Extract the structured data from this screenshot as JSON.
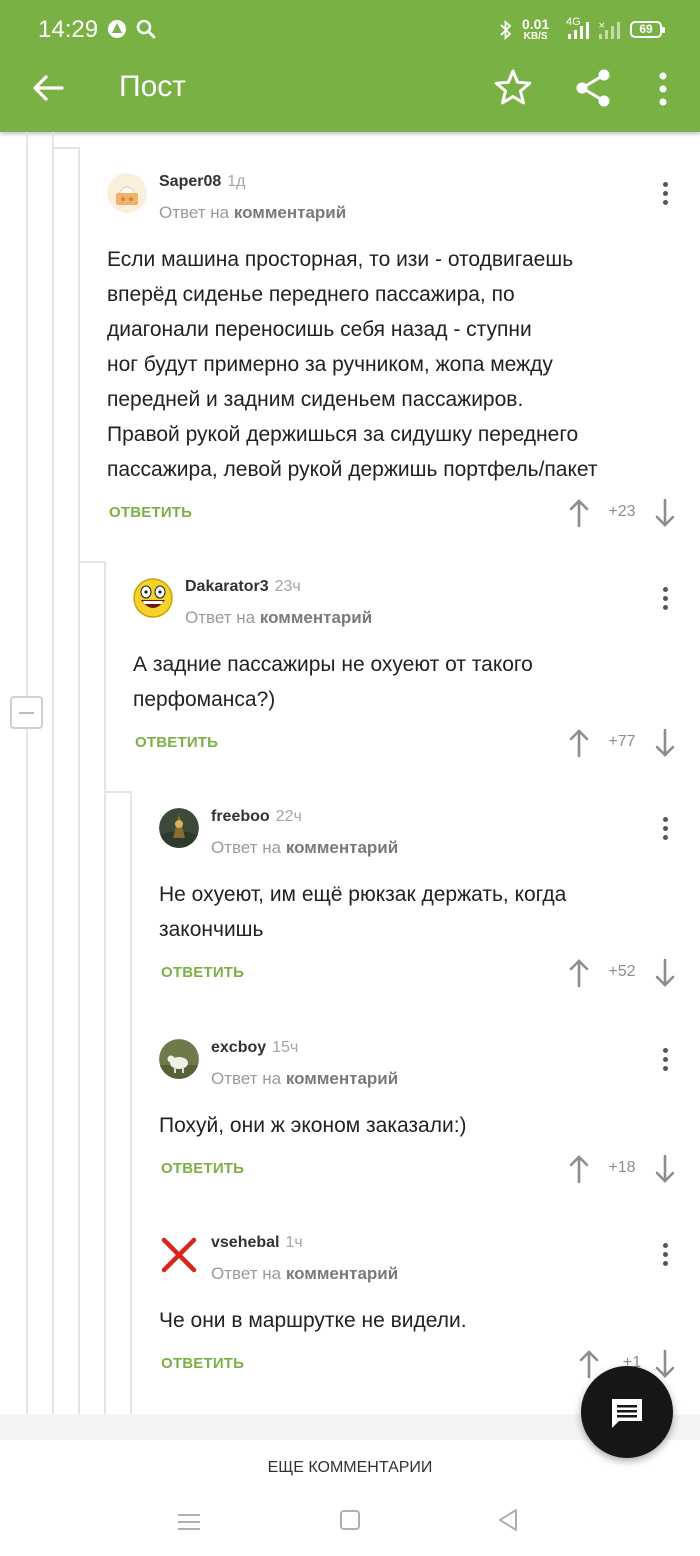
{
  "status_bar": {
    "time": "14:29",
    "net_speed_value": "0.01",
    "net_speed_unit": "KB/S",
    "network": "4G",
    "battery": "69"
  },
  "app_bar": {
    "title": "Пост"
  },
  "comments": [
    {
      "user": "Saper08",
      "time": "1д",
      "reply_prefix": "Ответ на",
      "reply_target": "комментарий",
      "text_lines": [
        "Если машина просторная, то изи - отодвигаешь",
        "вперёд сиденье переднего пассажира, по",
        "диагонали переносишь себя назад - ступни",
        "ног будут примерно за ручником, жопа между",
        "передней и задним сиденьем пассажиров.",
        "Правой рукой держишься за сидушку переднего",
        "пассажира, левой рукой держишь портфель/пакет"
      ],
      "reply_label": "ОТВЕТИТЬ",
      "score": "+23"
    },
    {
      "user": "Dakarator3",
      "time": "23ч",
      "reply_prefix": "Ответ на",
      "reply_target": "комментарий",
      "text_lines": [
        "А задние пассажиры не охуеют от такого",
        "перфоманса?)"
      ],
      "reply_label": "ОТВЕТИТЬ",
      "score": "+77"
    },
    {
      "user": "freeboo",
      "time": "22ч",
      "reply_prefix": "Ответ на",
      "reply_target": "комментарий",
      "text_lines": [
        "Не охуеют, им ещё рюкзак держать, когда",
        "закончишь"
      ],
      "reply_label": "ОТВЕТИТЬ",
      "score": "+52"
    },
    {
      "user": "excboy",
      "time": "15ч",
      "reply_prefix": "Ответ на",
      "reply_target": "комментарий",
      "text_lines": [
        "Похуй, они ж эконом заказали:)"
      ],
      "reply_label": "ОТВЕТИТЬ",
      "score": "+18"
    },
    {
      "user": "vsehebal",
      "time": "1ч",
      "reply_prefix": "Ответ на",
      "reply_target": "комментарий",
      "text_lines": [
        "Че они в маршрутке не видели."
      ],
      "reply_label": "ОТВЕТИТЬ",
      "score": "+1"
    }
  ],
  "more_comments_label": "ЕЩЕ КОММЕНТАРИИ",
  "colors": {
    "accent": "#79b144",
    "fab": "#161616"
  }
}
